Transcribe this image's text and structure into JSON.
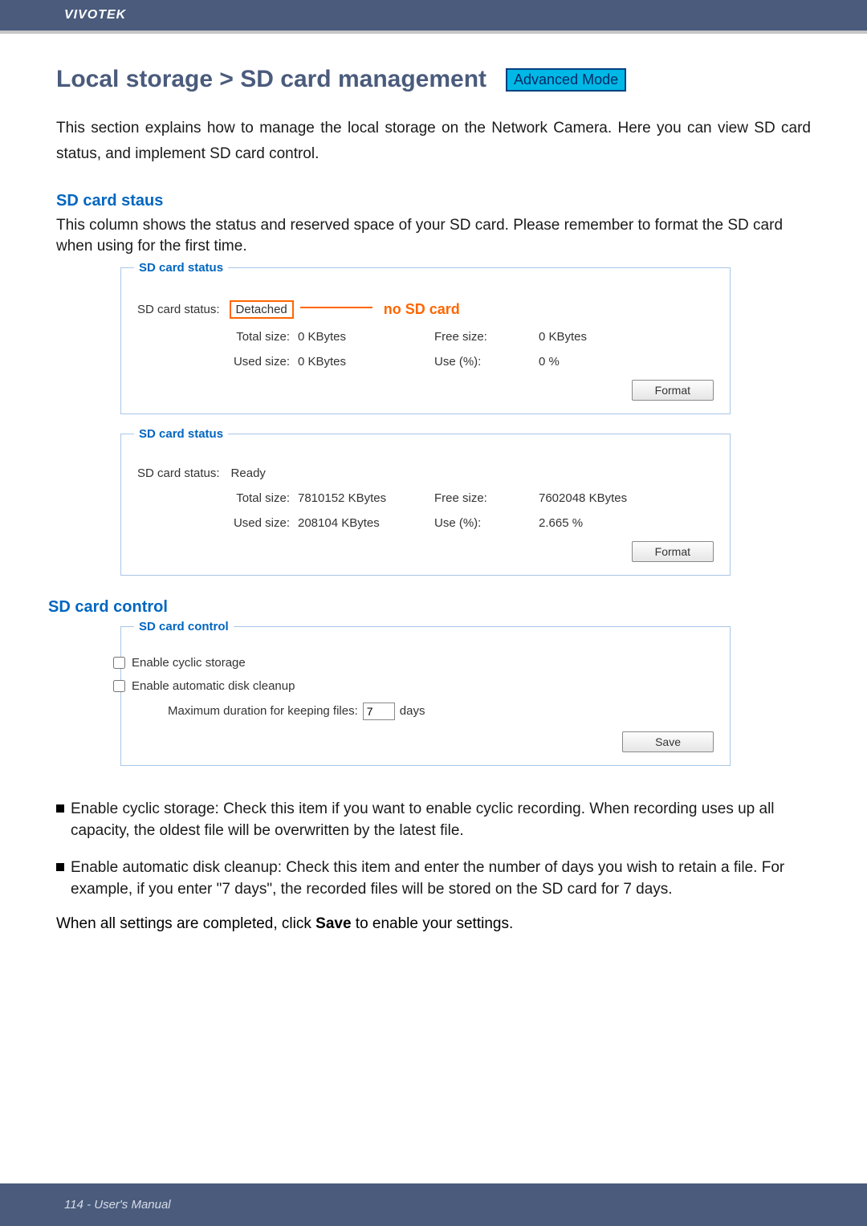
{
  "brand": "VIVOTEK",
  "page_title": "Local storage > SD card management",
  "mode_badge": "Advanced Mode",
  "intro": "This section explains how to manage the local storage on the Network Camera. Here you can view SD card status, and implement SD card control.",
  "status_section": {
    "heading": "SD card staus",
    "desc": "This column shows the status and reserved space of your SD card. Please remember to format the SD card when using for the first time.",
    "panels": [
      {
        "legend": "SD card status",
        "status_label": "SD card status:",
        "status_value": "Detached",
        "highlight": true,
        "annotation": "no SD card",
        "rows": {
          "total_label": "Total size:",
          "total_value": "0  KBytes",
          "free_label": "Free size:",
          "free_value": "0  KBytes",
          "used_label": "Used size:",
          "used_value": "0  KBytes",
          "pct_label": "Use (%):",
          "pct_value": "0 %"
        },
        "format_btn": "Format"
      },
      {
        "legend": "SD card status",
        "status_label": "SD card status:",
        "status_value": "Ready",
        "highlight": false,
        "rows": {
          "total_label": "Total size:",
          "total_value": "7810152  KBytes",
          "free_label": "Free size:",
          "free_value": "7602048  KBytes",
          "used_label": "Used size:",
          "used_value": "208104  KBytes",
          "pct_label": "Use (%):",
          "pct_value": "2.665 %"
        },
        "format_btn": "Format"
      }
    ]
  },
  "control_section": {
    "heading": "SD card control",
    "legend": "SD card control",
    "cyclic_label": "Enable cyclic storage",
    "cleanup_label": "Enable automatic disk cleanup",
    "max_dur_label": "Maximum duration for keeping files:",
    "max_dur_value": "7",
    "max_dur_unit": "days",
    "save_btn": "Save"
  },
  "bullets": [
    "Enable cyclic storage: Check this item if you want to enable cyclic recording. When recording uses up all capacity, the oldest file will be overwritten by the latest file.",
    "Enable automatic disk cleanup: Check this item and enter the number of days you wish to retain a file. For example, if you enter \"7 days\", the recorded files will be stored on the SD card for 7 days."
  ],
  "final_note_pre": "When all settings are completed, click ",
  "final_note_bold": "Save",
  "final_note_post": " to enable your settings.",
  "footer": "114 - User's Manual"
}
